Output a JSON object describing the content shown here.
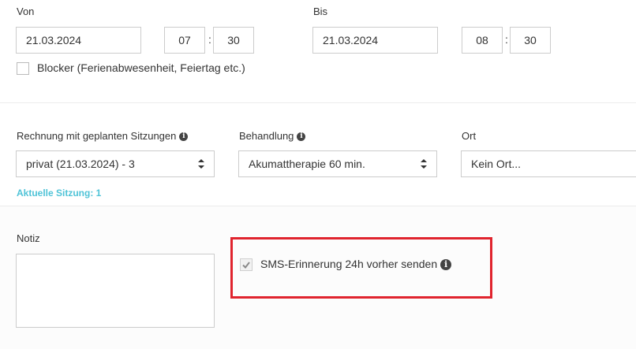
{
  "time_range": {
    "from_label": "Von",
    "from_date": "21.03.2024",
    "from_hour": "07",
    "from_minute": "30",
    "to_label": "Bis",
    "to_date": "21.03.2024",
    "to_hour": "08",
    "to_minute": "30",
    "time_separator": ":"
  },
  "blocker": {
    "label": "Blocker (Ferienabwesenheit, Feiertag etc.)",
    "checked": false
  },
  "billing": {
    "invoice_label": "Rechnung mit geplanten Sitzungen",
    "invoice_value": "privat (21.03.2024) - 3",
    "treatment_label": "Behandlung",
    "treatment_value": "Akumattherapie 60 min.",
    "location_label": "Ort",
    "location_value": "Kein Ort...",
    "current_session": "Aktuelle Sitzung: 1"
  },
  "notes": {
    "label": "Notiz",
    "value": ""
  },
  "sms": {
    "label": "SMS-Erinnerung 24h vorher senden",
    "checked": true
  },
  "colors": {
    "accent": "#4fc3d7",
    "highlight": "#e0242e",
    "border": "#cccccc"
  }
}
